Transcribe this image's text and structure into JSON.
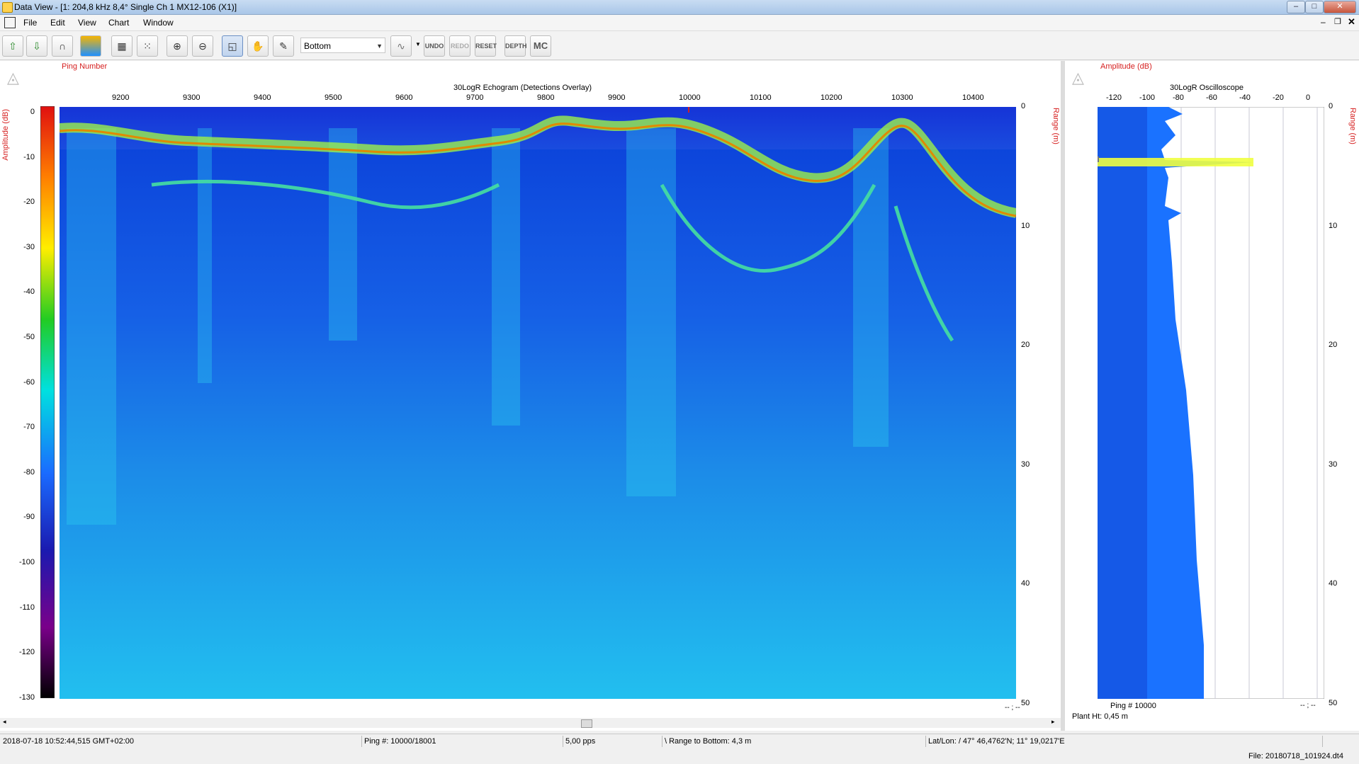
{
  "window": {
    "title": "Data View - [1: 204,8 kHz 8,4° Single Ch 1 MX12-106 (X1)]"
  },
  "menu": [
    "File",
    "Edit",
    "View",
    "Chart",
    "Window"
  ],
  "toolbar": {
    "select_value": "Bottom",
    "undo_label": "UNDO",
    "redo_label": "REDO",
    "reset_label": "RESET",
    "depth_label": "DEPTH",
    "mc_label": "MC"
  },
  "echogram": {
    "ping_number_label": "Ping Number",
    "title": "30LogR Echogram (Detections Overlay)",
    "amplitude_label": "Amplitude (dB)",
    "range_label": "Range (m)",
    "x_ticks": [
      "9200",
      "9300",
      "9400",
      "9500",
      "9600",
      "9700",
      "9800",
      "9900",
      "10000",
      "10100",
      "10200",
      "10300",
      "10400"
    ],
    "colorbar_ticks": [
      "0",
      "-10",
      "-20",
      "-30",
      "-40",
      "-50",
      "-60",
      "-70",
      "-80",
      "-90",
      "-100",
      "-110",
      "-120",
      "-130"
    ],
    "range_ticks": [
      "0",
      "10",
      "20",
      "30",
      "40",
      "50"
    ],
    "corner_readout": "-- ; --"
  },
  "oscilloscope": {
    "amplitude_label": "Amplitude (dB)",
    "title": "30LogR Oscilloscope",
    "range_label": "Range (m)",
    "x_ticks": [
      "-120",
      "-100",
      "-80",
      "-60",
      "-40",
      "-20",
      "0"
    ],
    "range_ticks": [
      "0",
      "10",
      "20",
      "30",
      "40",
      "50"
    ],
    "ping_readout": "Ping # 10000",
    "plant_height": "Plant Ht: 0,45 m",
    "corner_readout": "-- ; --"
  },
  "status": {
    "datetime": "2018-07-18 10:52:44,515 GMT+02:00",
    "ping": "Ping #: 10000/18001",
    "rate": "5,00 pps",
    "range_to_bottom": "\\ Range to Bottom: 4,3 m",
    "latlon": "Lat/Lon: / 47° 46,4762'N; 11° 19,0217'E",
    "file": "File:  20180718_101924.dt4"
  },
  "colors": {
    "accent_red": "#d62020",
    "echo_background": "#1a5fe0",
    "bottom_line": "#e08a00"
  }
}
